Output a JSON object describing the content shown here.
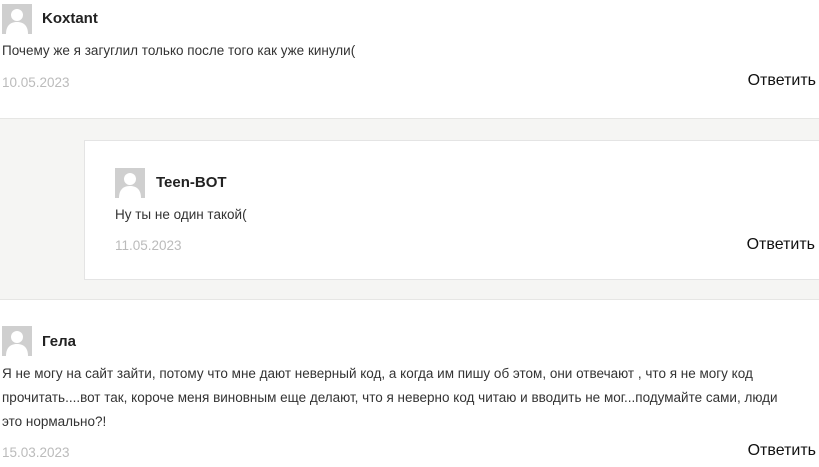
{
  "comments": [
    {
      "author": "Koxtant",
      "text": "Почему же я загуглил только после того как уже кинули(",
      "date": "10.05.2023",
      "reply_label": "Ответить"
    },
    {
      "author": "Teen-BOT",
      "text": "Ну ты не один такой(",
      "date": "11.05.2023",
      "reply_label": "Ответить"
    },
    {
      "author": "Гела",
      "text_lines": [
        "Я не могу на сайт зайти, потому что мне дают неверный код, а когда им пишу об этом, они отвечают , что я не могу код",
        "прочитать....вот так, короче меня виновным еще делают, что я неверно код читаю и вводить не мог...подумайте сами, люди",
        "это нормально?!"
      ],
      "date": "15.03.2023",
      "reply_label": "Ответить"
    }
  ],
  "icons": {
    "avatar": "default-user-avatar-icon"
  },
  "colors": {
    "nested_bg": "#f5f5f3",
    "date": "#bbbbbb",
    "avatar_bg": "#cfcfcf"
  }
}
